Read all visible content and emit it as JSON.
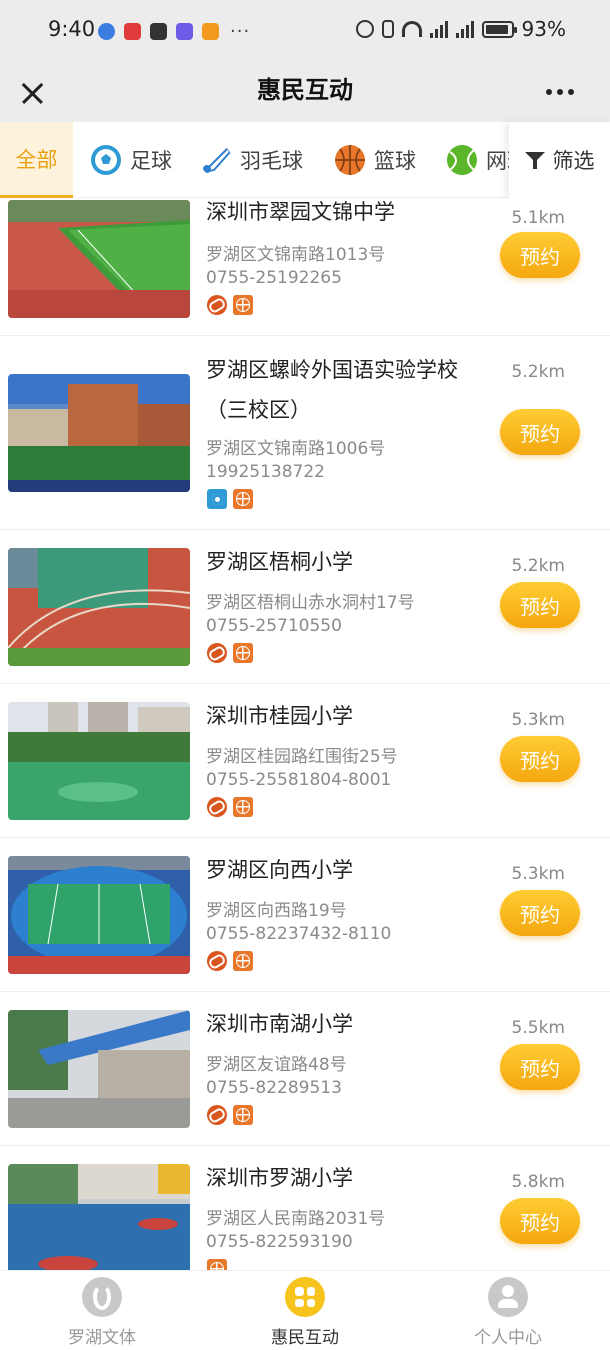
{
  "status_bar": {
    "time": "9:40",
    "more": "···",
    "network": "4G",
    "battery": "93%",
    "battery_level": 0.93
  },
  "header": {
    "title": "惠民互动"
  },
  "tabs": [
    {
      "label": "全部",
      "icon": "none",
      "active": true
    },
    {
      "label": "足球",
      "icon": "soccer-ball-icon",
      "active": false
    },
    {
      "label": "羽毛球",
      "icon": "shuttlecock-icon",
      "active": false
    },
    {
      "label": "篮球",
      "icon": "basketball-icon",
      "active": false
    },
    {
      "label": "网球",
      "icon": "tennis-ball-icon",
      "active": false
    }
  ],
  "filter_label": "筛选",
  "book_label": "预约",
  "venues": [
    {
      "name": "深圳市翠园文锦中学",
      "address": "罗湖区文锦南路1013号",
      "phone": "0755-25192265",
      "distance": "5.1km",
      "sports": [
        "track",
        "basketball"
      ]
    },
    {
      "name": "罗湖区螺岭外国语实验学校（三校区）",
      "address": "罗湖区文锦南路1006号",
      "phone": "19925138722",
      "distance": "5.2km",
      "sports": [
        "soccer",
        "basketball"
      ]
    },
    {
      "name": "罗湖区梧桐小学",
      "address": "罗湖区梧桐山赤水洞村17号",
      "phone": "0755-25710550",
      "distance": "5.2km",
      "sports": [
        "track",
        "basketball"
      ]
    },
    {
      "name": "深圳市桂园小学",
      "address": "罗湖区桂园路红围街25号",
      "phone": "0755-25581804-8001",
      "distance": "5.3km",
      "sports": [
        "track",
        "basketball"
      ]
    },
    {
      "name": "罗湖区向西小学",
      "address": "罗湖区向西路19号",
      "phone": "0755-82237432-8110",
      "distance": "5.3km",
      "sports": [
        "track",
        "basketball"
      ]
    },
    {
      "name": "深圳市南湖小学",
      "address": "罗湖区友谊路48号",
      "phone": "0755-82289513",
      "distance": "5.5km",
      "sports": [
        "track",
        "basketball"
      ]
    },
    {
      "name": "深圳市罗湖小学",
      "address": "罗湖区人民南路2031号",
      "phone": "0755-822593190",
      "distance": "5.8km",
      "sports": [
        "basketball"
      ]
    }
  ],
  "bottom_nav": [
    {
      "label": "罗湖文体",
      "icon": "luohu-logo-icon",
      "active": false
    },
    {
      "label": "惠民互动",
      "icon": "grid-icon",
      "active": true
    },
    {
      "label": "个人中心",
      "icon": "person-icon",
      "active": false
    }
  ],
  "colors": {
    "accent": "#f4a70f",
    "tab_active_bg": "#fdf3dc",
    "track_icon": "#d9561e",
    "basketball_icon": "#e8772a",
    "soccer_icon": "#2f9bd6"
  }
}
